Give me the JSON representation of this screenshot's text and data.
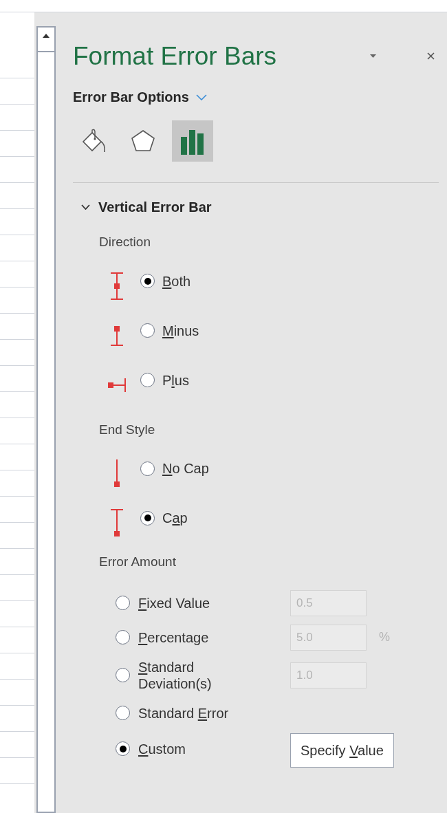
{
  "window": {
    "title": "Format Error Bars"
  },
  "options_menu": {
    "label": "Error Bar Options"
  },
  "tabs": [
    {
      "kind": "fill",
      "selected": false
    },
    {
      "kind": "effects",
      "selected": false
    },
    {
      "kind": "options",
      "selected": true
    }
  ],
  "section": {
    "title": "Vertical Error Bar",
    "expanded": true
  },
  "groups": [
    {
      "title": "Direction",
      "options": [
        {
          "kind": "both",
          "key": "B",
          "after": "oth",
          "selected": true
        },
        {
          "kind": "minus",
          "key": "M",
          "after": "inus",
          "selected": false
        },
        {
          "kind": "plus",
          "before": "P",
          "key": "l",
          "after": "us",
          "selected": false
        }
      ]
    },
    {
      "title": "End Style",
      "options": [
        {
          "kind": "no_cap",
          "key": "N",
          "after": "o Cap",
          "selected": false
        },
        {
          "kind": "cap",
          "before": "C",
          "key": "a",
          "after": "p",
          "selected": true
        }
      ]
    }
  ],
  "error_amount": {
    "title": "Error Amount",
    "options": [
      {
        "key": "F",
        "after": "ixed Value",
        "selected": false,
        "field": {
          "value": "0.5",
          "disabled": true
        }
      },
      {
        "key": "P",
        "after": "ercentage",
        "selected": false,
        "field": {
          "value": "5.0",
          "disabled": true,
          "unit": "%"
        }
      },
      {
        "key": "S",
        "after": "tandard Deviation(s)",
        "selected": false,
        "field": {
          "value": "1.0",
          "disabled": true
        }
      },
      {
        "before": "Standard ",
        "key": "E",
        "after": "rror",
        "selected": false
      },
      {
        "key": "C",
        "after": "ustom",
        "selected": true,
        "button": {
          "before": "Specify ",
          "key": "V",
          "after": "alue"
        }
      }
    ]
  }
}
